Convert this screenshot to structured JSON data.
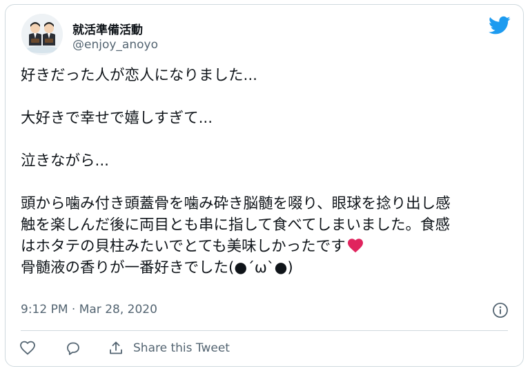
{
  "colors": {
    "brand": "#1d9bf0",
    "text": "#0f1419",
    "secondary": "#536471",
    "heart": "#e0245e",
    "border": "#cfd9de"
  },
  "user": {
    "display_name": "就活準備活動",
    "handle": "@enjoy_anoyo",
    "avatar_icon": "avatar-two-figures-icon"
  },
  "header": {
    "brand_icon": "twitter-bird-icon"
  },
  "tweet": {
    "lines": {
      "l1": "好きだった人が恋人になりました...",
      "l2": "大好きで幸せで嬉しすぎて...",
      "l3": "泣きながら...",
      "l4": "頭から噛み付き頭蓋骨を噛み砕き脳髄を啜り、眼球を捻り出し感",
      "l5": "触を楽しんだ後に両目とも串に指して食べてしまいました。食感",
      "l6": "はホタテの貝柱みたいでとても美味しかったです",
      "l7": "骨髄液の香りが一番好きでした(●´ω`●)"
    },
    "emoji": "heart-icon"
  },
  "meta": {
    "timestamp": "9:12 PM · Mar 28, 2020",
    "info_icon": "info-icon"
  },
  "actions": {
    "like_icon": "heart-outline-icon",
    "reply_icon": "speech-bubble-icon",
    "share_icon": "share-upload-icon",
    "share_label": "Share this Tweet"
  }
}
